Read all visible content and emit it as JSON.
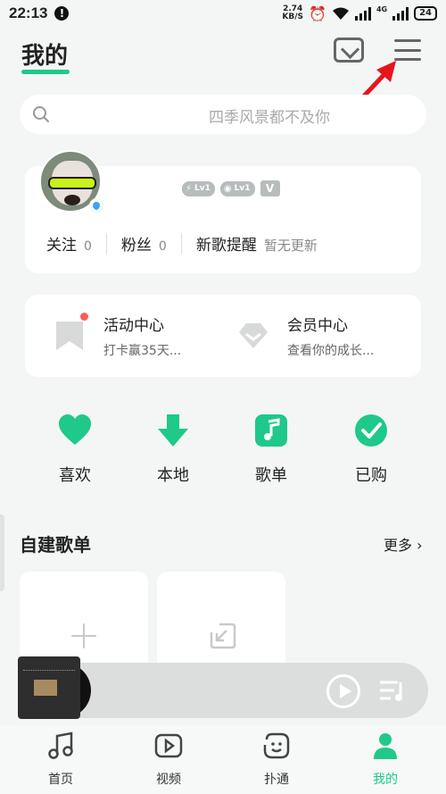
{
  "status_bar": {
    "time": "22:13",
    "net_speed": "2.74",
    "net_unit": "KB/S",
    "net_type": "4G",
    "battery": "24"
  },
  "header": {
    "title": "我的"
  },
  "search": {
    "placeholder": "四季风景都不及你"
  },
  "profile": {
    "levels": [
      "Lv1",
      "Lv1"
    ],
    "vip_badge": "V",
    "stats": [
      {
        "label": "关注",
        "value": "0"
      },
      {
        "label": "粉丝",
        "value": "0"
      },
      {
        "label": "新歌提醒",
        "value": "暂无更新"
      }
    ]
  },
  "activity": [
    {
      "label": "活动中心",
      "sub": "打卡赢35天..."
    },
    {
      "label": "会员中心",
      "sub": "查看你的成长..."
    }
  ],
  "quick_actions": [
    {
      "label": "喜欢",
      "icon": "heart-icon"
    },
    {
      "label": "本地",
      "icon": "download-icon"
    },
    {
      "label": "歌单",
      "icon": "music-note-icon"
    },
    {
      "label": "已购",
      "icon": "check-circle-icon"
    }
  ],
  "playlists": {
    "title": "自建歌单",
    "more": "更多"
  },
  "tabs": [
    {
      "label": "首页",
      "icon": "music-note-icon"
    },
    {
      "label": "视频",
      "icon": "video-play-icon"
    },
    {
      "label": "扑通",
      "icon": "smile-face-icon"
    },
    {
      "label": "我的",
      "icon": "profile-icon"
    }
  ],
  "colors": {
    "accent": "#1ec98a",
    "background": "#f4f6f6",
    "annotation_arrow": "#e8141c"
  }
}
